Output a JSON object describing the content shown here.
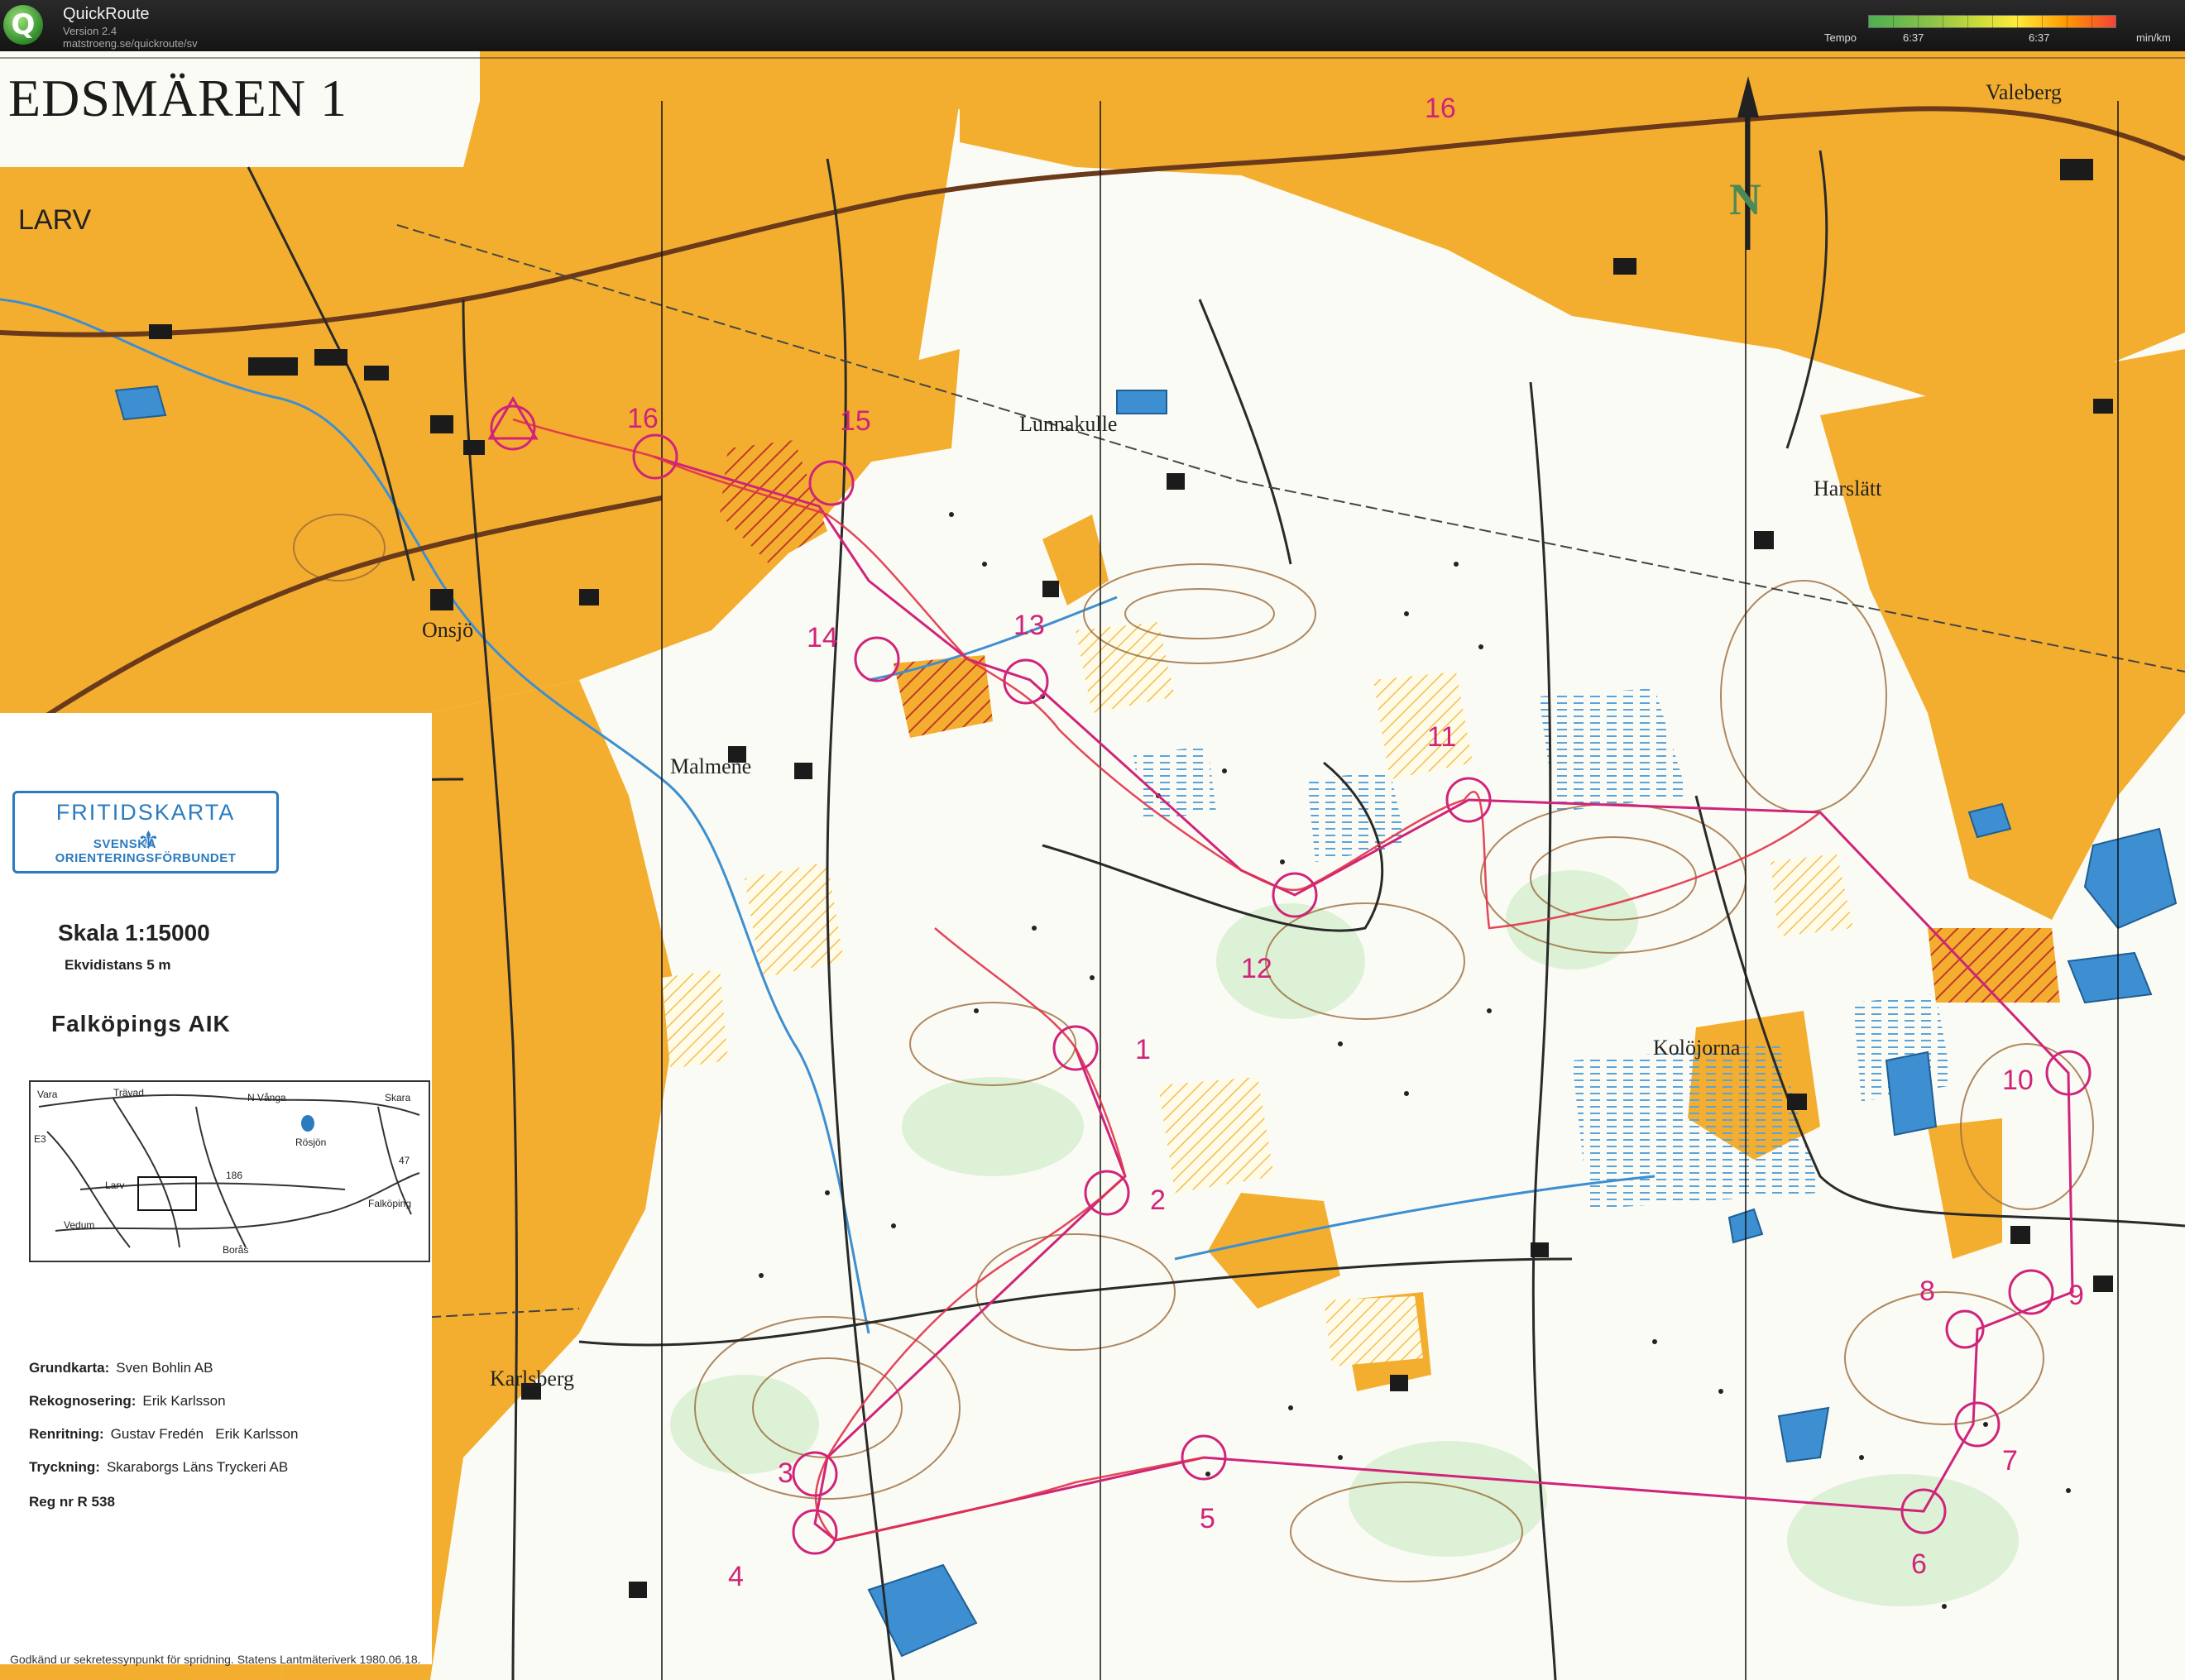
{
  "app": {
    "title": "QuickRoute",
    "version": "Version 2.4",
    "url": "matstroeng.se/quickroute/sv",
    "icon": "quickroute-q-icon"
  },
  "tempo": {
    "label": "Tempo",
    "min": "6:37",
    "max": "6:37",
    "unit": "min/km"
  },
  "map": {
    "title": "EDSMÄREN 1",
    "places": {
      "larv": "LARV",
      "onsjo": "Onsjö",
      "lunnakulle": "Lunnakulle",
      "malmene": "Malmene",
      "harslatt": "Harslätt",
      "valeberg": "Valeberg",
      "kolojorna": "Kolöjorna",
      "karlsberg": "Karlsberg"
    },
    "north": "N",
    "controls": [
      "1",
      "2",
      "3",
      "4",
      "5",
      "6",
      "7",
      "8",
      "9",
      "10",
      "11",
      "12",
      "13",
      "14",
      "15",
      "16",
      "16"
    ]
  },
  "legend": {
    "fritid_title": "FRITIDSKARTA",
    "fritid_sub_left": "SVENSKA",
    "fritid_sub_right": "ORIENTERINGSFÖRBUNDET",
    "scale": "Skala 1:15000",
    "equidistance": "Ekvidistans 5 m",
    "club": "Falköpings AIK",
    "overview": {
      "vara": "Vara",
      "travad": "Trävad",
      "n_vanga": "N Vånga",
      "skara": "Skara",
      "e3": "E3",
      "rosjon": "Rösjön",
      "larv": "Larv",
      "r186": "186",
      "r47": "47",
      "vedum": "Vedum",
      "falkoping": "Falköping",
      "boras": "Borås"
    },
    "credits": [
      {
        "label": "Grundkarta:",
        "value": "Sven Bohlin AB"
      },
      {
        "label": "Rekognosering:",
        "value": "Erik Karlsson"
      },
      {
        "label": "Renritning:",
        "value": "Gustav Fredén   Erik Karlsson"
      },
      {
        "label": "Tryckning:",
        "value": "Skaraborgs Läns Tryckeri AB"
      }
    ],
    "reg": "Reg nr R 538",
    "disclaimer": "Godkänd ur sekretessynpunkt för spridning. Statens Lantmäteriverk 1980.06.18."
  },
  "colors": {
    "field_orange": "#f4ae2f",
    "course_magenta": "#d0247a",
    "water_blue": "#3d8fd1",
    "road_brown": "#6b3a1a"
  }
}
